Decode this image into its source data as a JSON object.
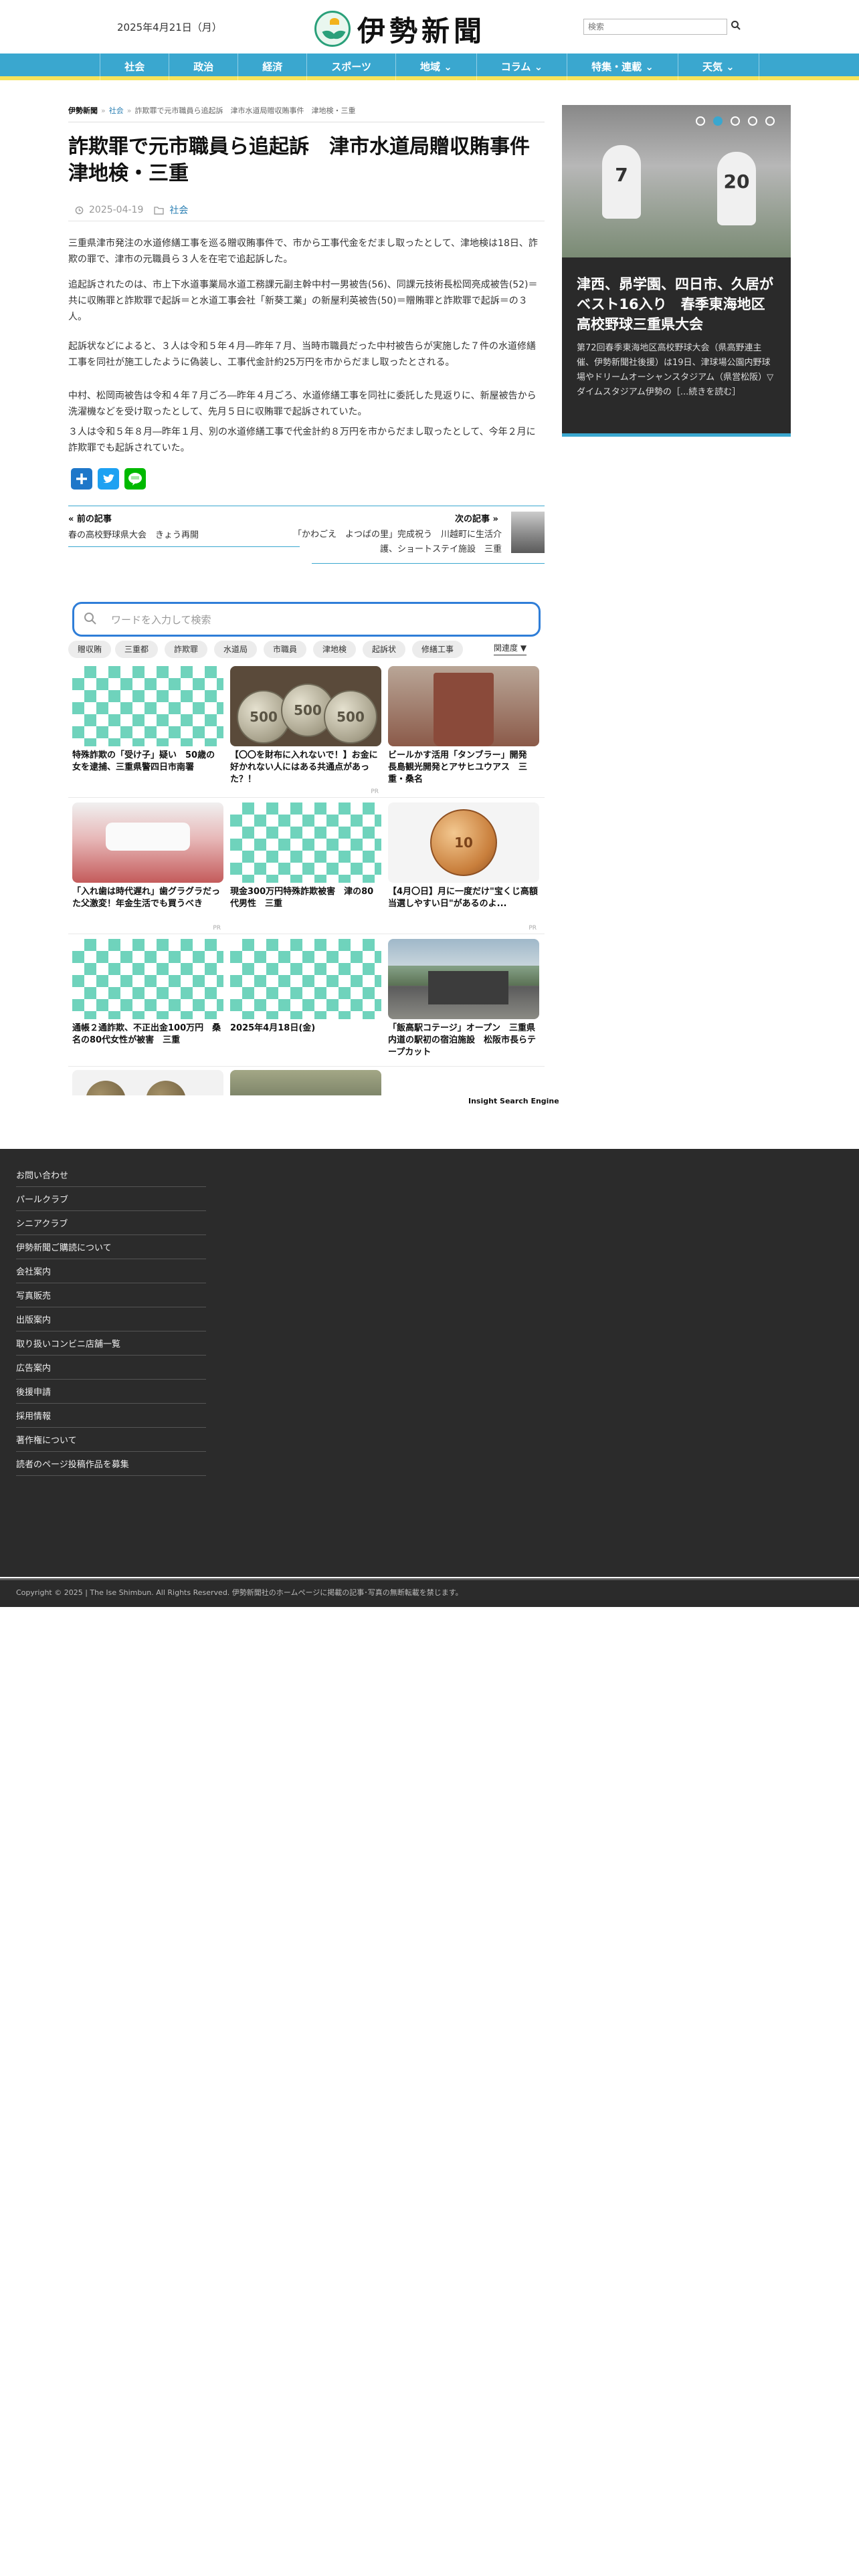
{
  "header": {
    "date": "2025年4月21日（月）",
    "brand": "伊勢新聞",
    "logo_badge": "伊勢新聞",
    "search_placeholder": "検索"
  },
  "nav": {
    "items": [
      "社会",
      "政治",
      "経済",
      "スポーツ",
      "地域 ⌄",
      "コラム ⌄",
      "特集・連載 ⌄",
      "天気 ⌄"
    ]
  },
  "breadcrumb": {
    "home": "伊勢新聞",
    "category": "社会",
    "current": "詐欺罪で元市職員ら追起訴　津市水道局贈収賄事件　津地検・三重"
  },
  "article": {
    "title": "詐欺罪で元市職員ら追起訴　津市水道局贈収賄事件　津地検・三重",
    "date": "2025-04-19",
    "category": "社会",
    "paragraphs": [
      "三重県津市発注の水道修繕工事を巡る贈収賄事件で、市から工事代金をだまし取ったとして、津地検は18日、詐欺の罪で、津市の元職員ら３人を在宅で追起訴した。",
      "追起訴されたのは、市上下水道事業局水道工務課元副主幹中村一男被告(56)、同課元技術長松岡亮成被告(52)＝共に収賄罪と詐欺罪で起訴＝と水道工事会社「新葵工業」の新屋利英被告(50)＝贈賄罪と詐欺罪で起訴＝の３人。",
      "起訴状などによると、３人は令和５年４月―昨年７月、当時市職員だった中村被告らが実施した７件の水道修繕工事を同社が施工したように偽装し、工事代金計約25万円を市からだまし取ったとされる。",
      "中村、松岡両被告は令和４年７月ごろ―昨年４月ごろ、水道修繕工事を同社に委託した見返りに、新屋被告から洗濯機などを受け取ったとして、先月５日に収賄罪で起訴されていた。",
      "３人は令和５年８月―昨年１月、別の水道修繕工事で代金計約８万円を市からだまし取ったとして、今年２月に詐欺罪でも起訴されていた。"
    ]
  },
  "share": {
    "icons": [
      "addtoany-icon",
      "twitter-icon",
      "line-icon"
    ]
  },
  "prev_next": {
    "prev_label": "« 前の記事",
    "prev_title": "春の高校野球県大会　きょう再開",
    "next_label": "次の記事 »",
    "next_title": "「かわごえ　よつばの里」完成祝う　川越町に生活介護、ショートステイ施設　三重"
  },
  "insight": {
    "search_placeholder": "ワードを入力して検索",
    "tags": [
      "贈収賄",
      "三重都",
      "詐欺罪",
      "水道局",
      "市職員",
      "津地検",
      "起訴状",
      "修繕工事"
    ],
    "sort_label": "関連度 ▼",
    "cards": [
      {
        "title": "特殊詐欺の「受け子」疑い　50歳の女を逮捕、三重県警四日市南署",
        "sponsor": ""
      },
      {
        "title": "【〇〇を財布に入れないで！】お金に好かれない人にはある共通点があった？！",
        "sponsor": "PR"
      },
      {
        "title": "ビールかす活用「タンブラー」開発　長島観光開発とアサヒユウアス　三重・桑名",
        "sponsor": ""
      },
      {
        "title": "「入れ歯は時代遅れ」歯グラグラだった父激変！年金生活でも買うべき",
        "sponsor": "PR"
      },
      {
        "title": "現金300万円特殊詐欺被害　津の80代男性　三重",
        "sponsor": ""
      },
      {
        "title": "【4月〇日】月に一度だけ\"宝くじ高額当選しやすい日\"があるのよ...",
        "sponsor": "PR"
      },
      {
        "title": "通帳２通詐欺、不正出金100万円　桑名の80代女性が被害　三重",
        "sponsor": ""
      },
      {
        "title": "2025年4月18日(金)",
        "sponsor": ""
      },
      {
        "title": "「飯高駅コテージ」オープン　三重県内道の駅初の宿泊施設　松阪市長らテープカット",
        "sponsor": ""
      }
    ],
    "coin_labels": [
      "500",
      "500",
      "500",
      "10"
    ],
    "engine": "Insight Search Engine"
  },
  "sidebar": {
    "slider_title": "津西、昴学園、四日市、久居がベスト16入り　春季東海地区高校野球三重県大会",
    "slider_desc": "第72回春季東海地区高校野球大会（県高野連主催、伊勢新聞社後援）は19日、津球場公園内野球場やドリームオーシャンスタジアム（県営松阪）▽ダイムスタジアム伊勢の［...続きを読む］",
    "player_numbers": [
      "7",
      "20"
    ],
    "dots": 5,
    "active_dot": 2
  },
  "footer": {
    "links": [
      "お問い合わせ",
      "パールクラブ",
      "シニアクラブ",
      "伊勢新聞ご購読について",
      "会社案内",
      "写真販売",
      "出版案内",
      "取り扱いコンビニ店舗一覧",
      "広告案内",
      "後援申請",
      "採用情報",
      "著作権について",
      "読者のページ投稿作品を募集"
    ],
    "copyright": "Copyright © 2025 | The Ise Shimbun. All Rights Reserved. 伊勢新聞社のホームページに掲載の記事･写真の無断転載を禁じます。"
  }
}
